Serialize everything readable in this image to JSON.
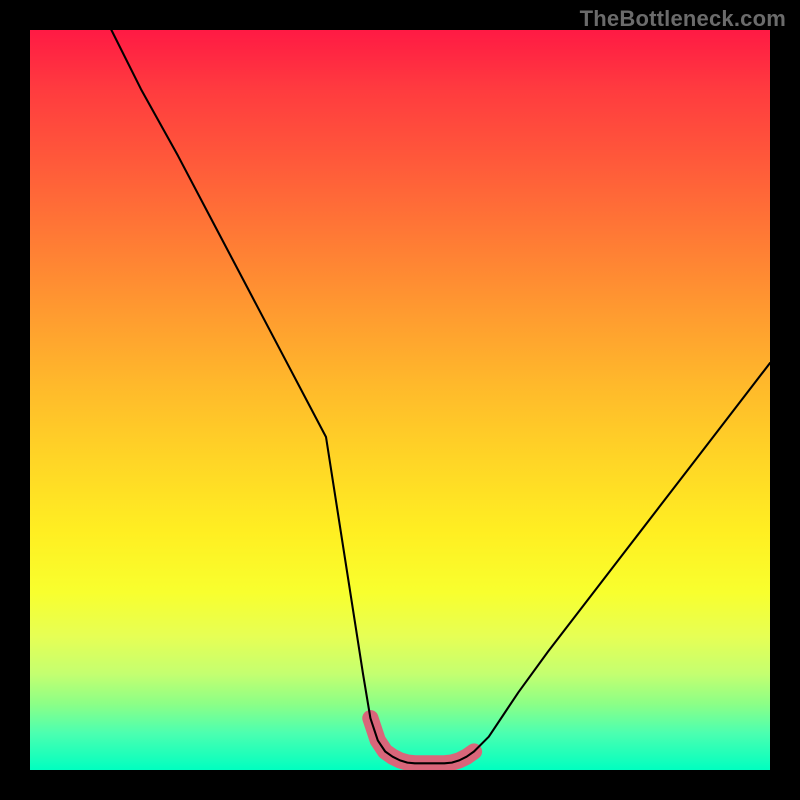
{
  "watermark": "TheBottleneck.com",
  "chart_data": {
    "type": "line",
    "title": "",
    "xlabel": "",
    "ylabel": "",
    "xlim": [
      0,
      100
    ],
    "ylim": [
      0,
      100
    ],
    "grid": false,
    "legend": false,
    "series": [
      {
        "name": "curve",
        "color": "#000000",
        "x": [
          11,
          15,
          20,
          25,
          30,
          35,
          40,
          45,
          46,
          47,
          48,
          49,
          50,
          51,
          52,
          53,
          54,
          55,
          56,
          57,
          58,
          59,
          60,
          62,
          64,
          66,
          70,
          75,
          80,
          85,
          90,
          95,
          100
        ],
        "y": [
          100,
          92,
          83,
          73.5,
          64,
          54.5,
          45,
          13,
          7,
          4,
          2.5,
          1.8,
          1.3,
          1.0,
          0.9,
          0.9,
          0.9,
          0.9,
          0.9,
          1.0,
          1.3,
          1.8,
          2.5,
          4.5,
          7.5,
          10.5,
          16,
          22.5,
          29,
          35.5,
          42,
          48.5,
          55
        ]
      },
      {
        "name": "thick-base",
        "color": "#d9667a",
        "x": [
          46,
          47,
          48,
          49,
          50,
          51,
          52,
          53,
          54,
          55,
          56,
          57,
          58,
          59,
          60
        ],
        "y": [
          7,
          4,
          2.5,
          1.8,
          1.3,
          1.0,
          0.9,
          0.9,
          0.9,
          0.9,
          0.9,
          1.0,
          1.3,
          1.8,
          2.5
        ]
      }
    ],
    "gradient_background": {
      "direction": "vertical",
      "stops": [
        {
          "pos": 0.0,
          "color": "#ff1a44"
        },
        {
          "pos": 0.5,
          "color": "#ffb92b"
        },
        {
          "pos": 0.75,
          "color": "#f8ff2e"
        },
        {
          "pos": 1.0,
          "color": "#00ffc0"
        }
      ]
    }
  }
}
